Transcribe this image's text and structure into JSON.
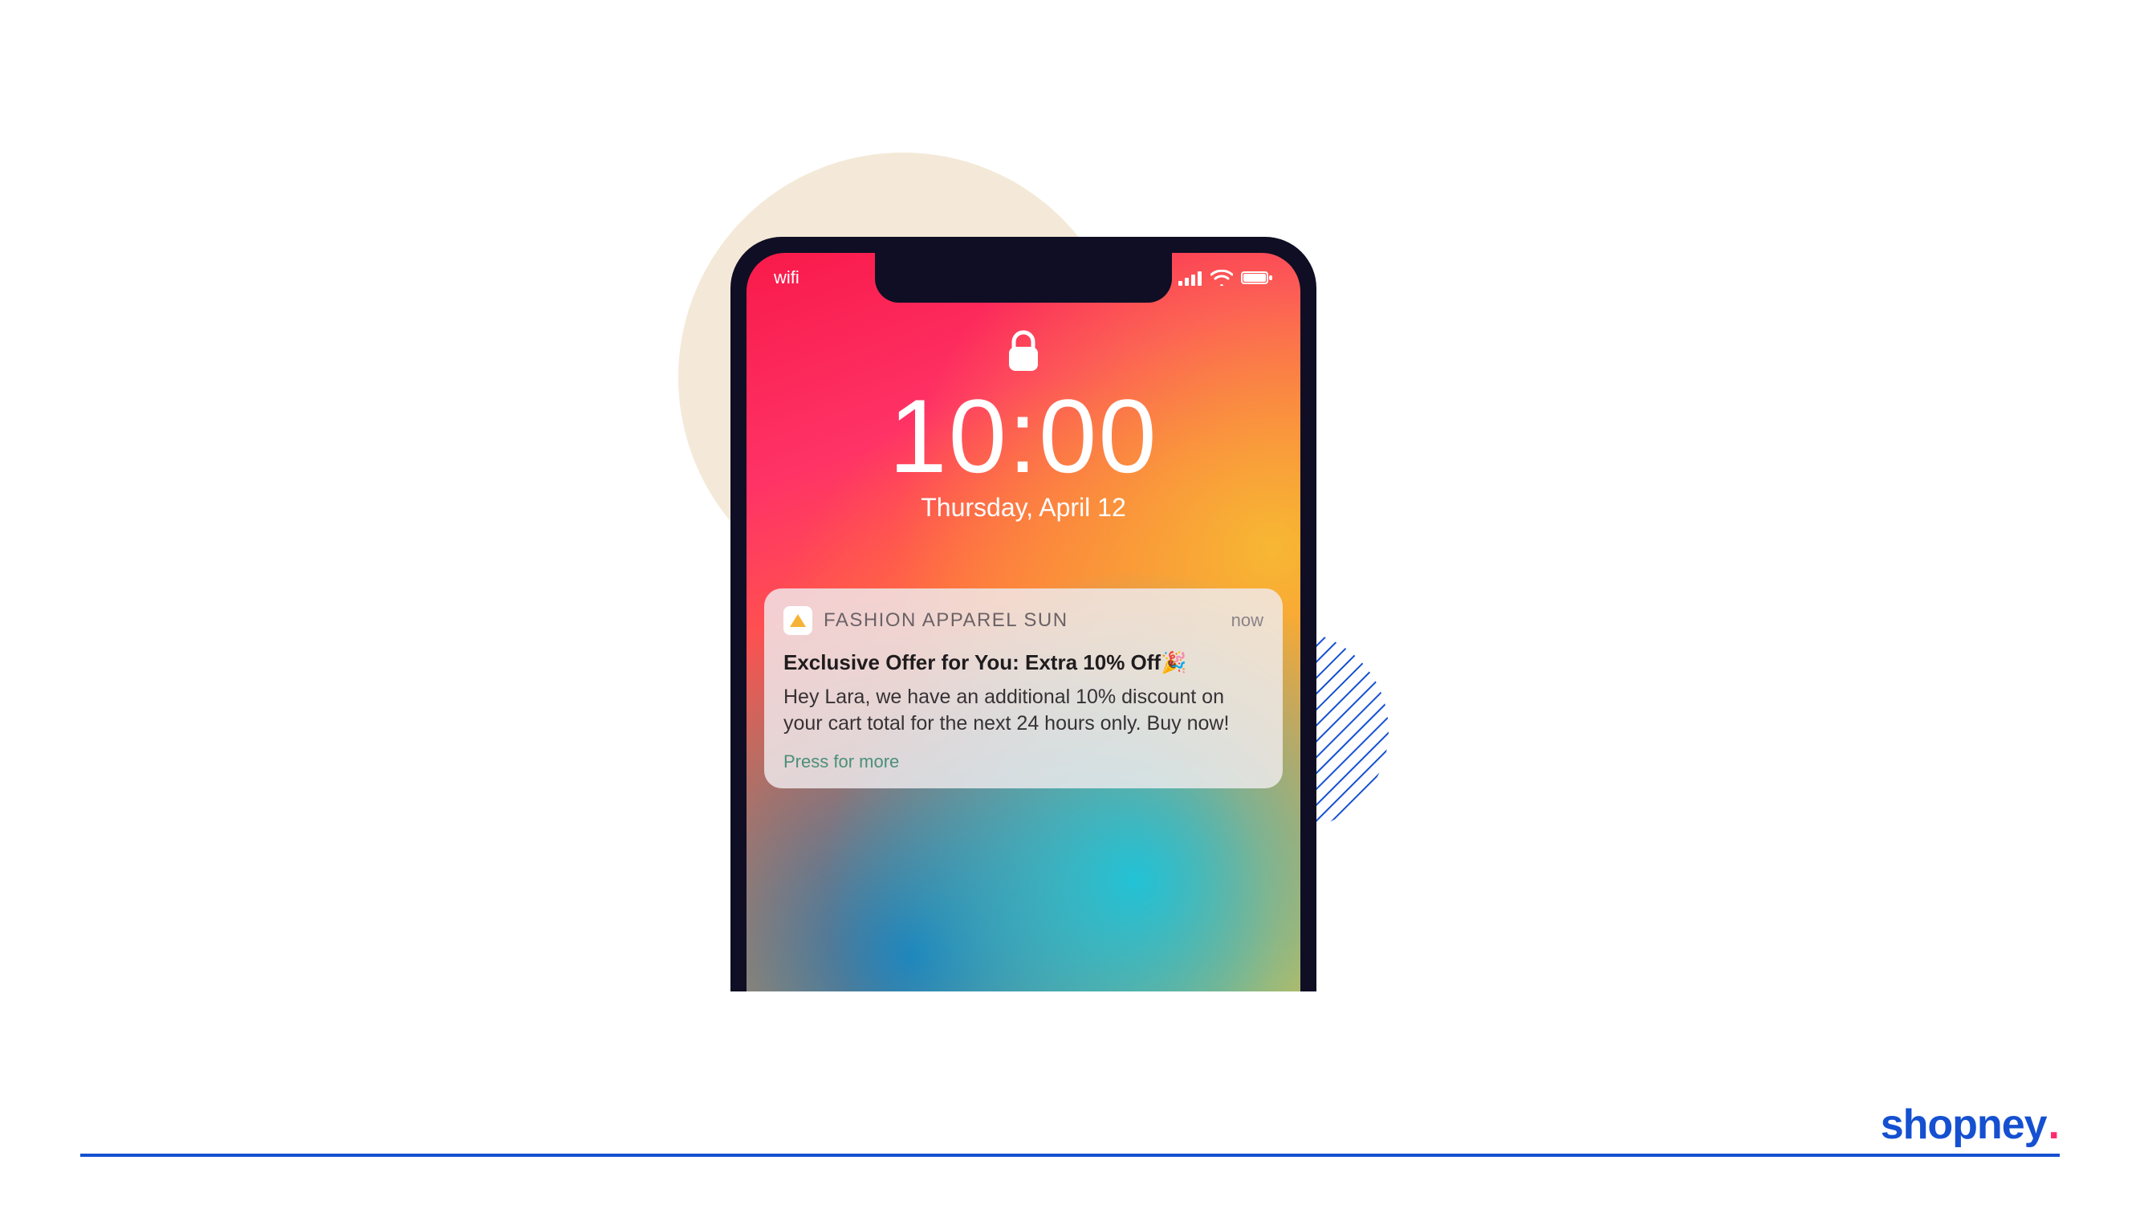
{
  "status_bar": {
    "wifi_label": "wifi"
  },
  "lock_screen": {
    "time": "10:00",
    "date": "Thursday, April 12"
  },
  "notification": {
    "app_name": "FASHION APPAREL SUN",
    "timestamp": "now",
    "title": "Exclusive Offer for You: Extra 10% Off🎉",
    "body": "Hey Lara, we have an additional 10% discount on your cart total for the next 24 hours only. Buy now!",
    "press_for_more": "Press for more"
  },
  "brand": {
    "name": "shopney",
    "dot": "."
  },
  "colors": {
    "brand_blue": "#1550d1",
    "brand_accent": "#ff2b6b",
    "beige": "#f4e9d8"
  }
}
